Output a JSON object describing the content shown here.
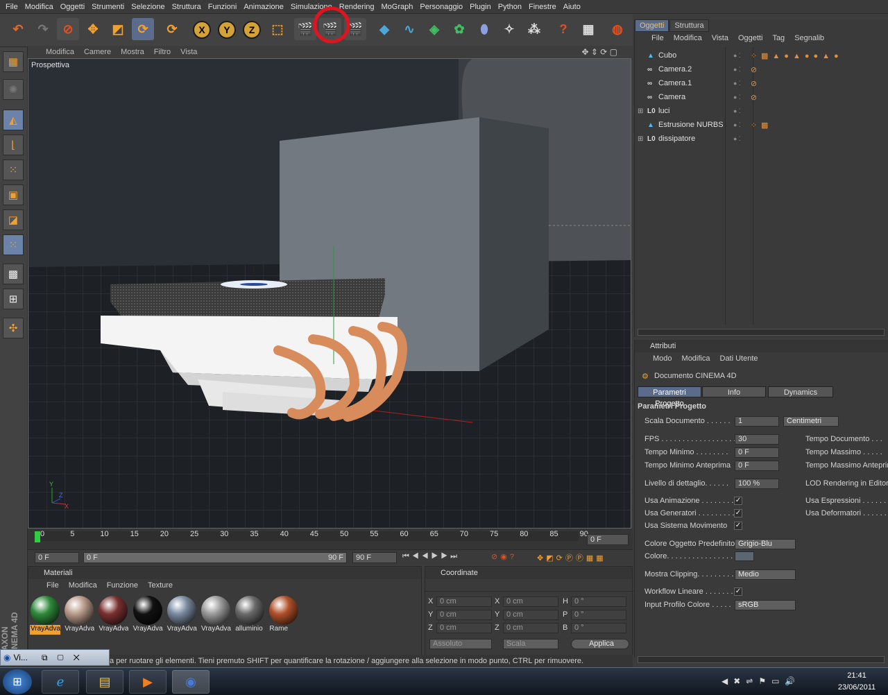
{
  "menubar": [
    "File",
    "Modifica",
    "Oggetti",
    "Strumenti",
    "Selezione",
    "Struttura",
    "Funzioni",
    "Animazione",
    "Simulazione",
    "Rendering",
    "MoGraph",
    "Personaggio",
    "Plugin",
    "Python",
    "Finestre",
    "Aiuto"
  ],
  "viewport": {
    "menu": [
      "Modifica",
      "Camere",
      "Mostra",
      "Filtro",
      "Vista"
    ],
    "label": "Prospettiva",
    "axis_x": "X",
    "axis_y": "Y",
    "axis_z": "Z"
  },
  "toolbar_icons": [
    "undo-icon",
    "redo-icon",
    "live-select-icon",
    "move-icon",
    "scale-icon",
    "rotate-icon",
    "last-tool-icon",
    "x-axis-lock",
    "y-axis-lock",
    "z-axis-lock",
    "coordinate-system-icon",
    "render-view-icon",
    "render-picture-viewer-icon",
    "edit-render-settings-icon",
    "cube-primitive-icon",
    "spline-icon",
    "nurbs-icon",
    "array-icon",
    "deformer-icon",
    "scene-icon",
    "particles-icon",
    "help-icon",
    "layer-manager-icon",
    "web-icon"
  ],
  "timeline": {
    "ticks": [
      "0",
      "5",
      "10",
      "15",
      "20",
      "25",
      "30",
      "35",
      "40",
      "45",
      "50",
      "55",
      "60",
      "65",
      "70",
      "75",
      "80",
      "85",
      "90"
    ],
    "current_frame": "0 F",
    "start": "0 F",
    "range_start": "0 F",
    "range_end": "90 F",
    "end": "90 F"
  },
  "materials": {
    "title": "Materiali",
    "menu": [
      "File",
      "Modifica",
      "Funzione",
      "Texture"
    ],
    "items": [
      {
        "label": "VrayAdva",
        "color": "#2f8a3a",
        "selected": true
      },
      {
        "label": "VrayAdva",
        "color": "#b89a8a"
      },
      {
        "label": "VrayAdva",
        "color": "#7a3030"
      },
      {
        "label": "VrayAdva",
        "color": "#111111"
      },
      {
        "label": "VrayAdva",
        "color": "#7a8aa0"
      },
      {
        "label": "VrayAdva",
        "color": "#9a9a9a"
      },
      {
        "label": "alluminio",
        "color": "#6a6a6a"
      },
      {
        "label": "Rame",
        "color": "#b0502a"
      }
    ]
  },
  "coordinates": {
    "title": "Coordinate",
    "rows": [
      {
        "a": "X",
        "av": "0 cm",
        "b": "X",
        "bv": "0 cm",
        "c": "H",
        "cv": "0 °"
      },
      {
        "a": "Y",
        "av": "0 cm",
        "b": "Y",
        "bv": "0 cm",
        "c": "P",
        "cv": "0 °"
      },
      {
        "a": "Z",
        "av": "0 cm",
        "b": "Z",
        "bv": "0 cm",
        "c": "B",
        "cv": "0 °"
      }
    ],
    "mode": "Assoluto",
    "scale": "Scala",
    "apply": "Applica"
  },
  "objects": {
    "tabs": [
      "Oggetti",
      "Struttura"
    ],
    "menu": [
      "File",
      "Modifica",
      "Vista",
      "Oggetti",
      "Tag",
      "Segnalib"
    ],
    "items": [
      "Cubo",
      "Camera.2",
      "Camera.1",
      "Camera",
      "luci",
      "Estrusione NURBS",
      "dissipatore"
    ]
  },
  "attributes": {
    "title": "Attributi",
    "menu": [
      "Modo",
      "Modifica",
      "Dati Utente"
    ],
    "doc": "Documento CINEMA 4D",
    "tabs": [
      "Parametri Progetto",
      "Info",
      "Dynamics"
    ],
    "section": "Parametri Progetto",
    "scala_label": "Scala Documento . . . . . .",
    "scala_value": "1",
    "scala_unit": "Centimetri",
    "fps_label": "FPS . . . . . . . . . . . . . . . . . .",
    "fps_value": "30",
    "tmin_label": "Tempo Minimo . . . . . . . .",
    "tmin_value": "0 F",
    "tminant_label": "Tempo Minimo Anteprima",
    "tminant_value": "0 F",
    "tdoc_label": "Tempo Documento . . .",
    "tmax_label": "Tempo Massimo . . . . .",
    "tmaxant_label": "Tempo Massimo Anteprim",
    "lod_label": "Livello di dettaglio. . . . . .",
    "lod_value": "100 %",
    "lodr_label": "LOD Rendering in Editor",
    "usa_anim": "Usa Animazione . . . . . . . .",
    "usa_gen": "Usa Generatori . . . . . . . . .",
    "usa_sist": "Usa Sistema Movimento",
    "usa_espr": "Usa Espressioni . . . . . . .",
    "usa_def": "Usa Deformatori . . . . . .",
    "colore_pred_label": "Colore Oggetto Predefinito",
    "colore_pred_value": "Grigio-Blu",
    "colore_label": "Colore. . . . . . . . . . . . . . . .",
    "clipping_label": "Mostra Clipping. . . . . . . . .",
    "clipping_value": "Medio",
    "workflow_label": "Workflow Lineare . . . . . . .",
    "profilo_label": "Input Profilo Colore . . . . .",
    "profilo_value": "sRGB"
  },
  "status": "cina per ruotare gli elementi. Tieni premuto SHIFT per quantificare la rotazione / aggiungere alla selezione in modo punto, CTRL per rimuovere.",
  "brand_side": "MAXON CINEMA 4D",
  "taskbar": {
    "minimized": "Vi...",
    "time": "21:41",
    "date": "23/06/2011"
  },
  "colors": {
    "accent": "#5a6b8c",
    "highlight": "#f0a030",
    "annotation": "#e0141e"
  }
}
